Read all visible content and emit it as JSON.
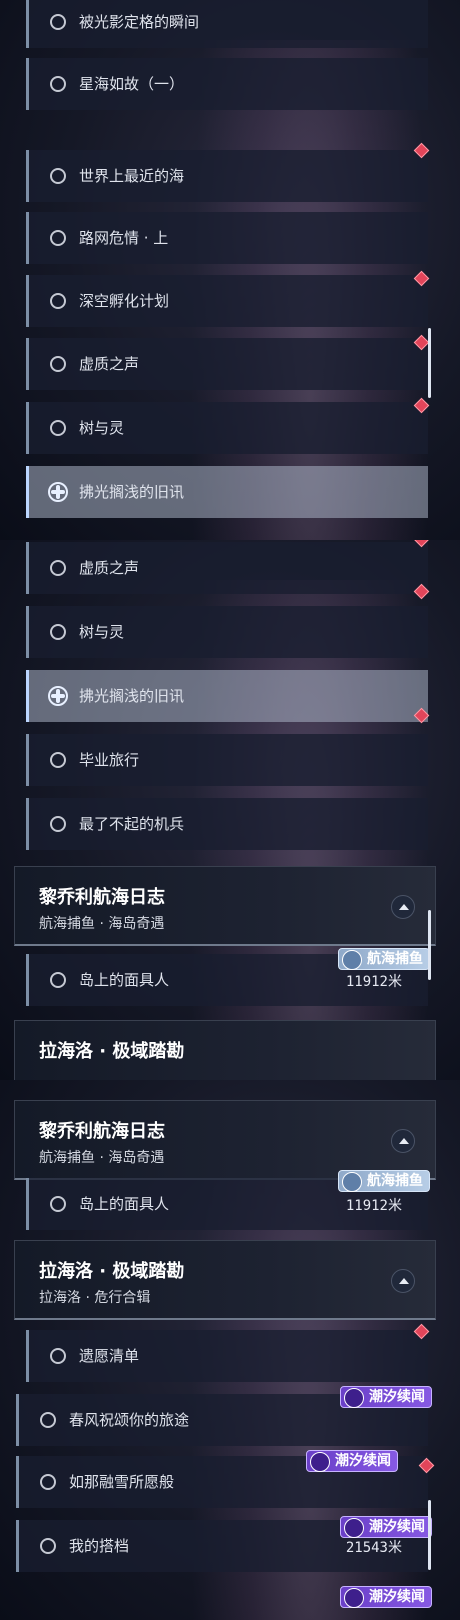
{
  "screen1": {
    "items": [
      {
        "label": "被光影定格的瞬间"
      },
      {
        "label": "星海如故（一）"
      },
      {
        "label": "世界上最近的海"
      },
      {
        "label": "路网危情 · 上"
      },
      {
        "label": "深空孵化计划"
      },
      {
        "label": "虚质之声"
      },
      {
        "label": "树与灵"
      },
      {
        "label": "拂光搁浅的旧讯"
      }
    ]
  },
  "screen2": {
    "items": [
      {
        "label": "虚质之声"
      },
      {
        "label": "树与灵"
      },
      {
        "label": "拂光搁浅的旧讯"
      },
      {
        "label": "毕业旅行"
      },
      {
        "label": "最了不起的机兵"
      }
    ],
    "group1": {
      "title": "黎乔利航海日志",
      "subtitle": "航海捕鱼 · 海岛奇遇"
    },
    "tag_blue": "航海捕鱼",
    "island_item": {
      "label": "岛上的面具人",
      "distance": "11912米"
    },
    "group2": {
      "title": "拉海洛 · 极域踏勘"
    }
  },
  "screen3": {
    "group1": {
      "title": "黎乔利航海日志",
      "subtitle": "航海捕鱼 · 海岛奇遇"
    },
    "tag_blue": "航海捕鱼",
    "island_item": {
      "label": "岛上的面具人",
      "distance": "11912米"
    },
    "group2": {
      "title": "拉海洛 · 极域踏勘",
      "subtitle": "拉海洛 · 危行合辑"
    },
    "items": [
      {
        "label": "遗愿清单"
      },
      {
        "label": "春风祝颂你的旅途"
      },
      {
        "label": "如那融雪所愿般"
      },
      {
        "label": "我的搭档",
        "distance": "21543米"
      }
    ],
    "tag_purple": "潮汐续闻"
  },
  "colors": {
    "accent_red": "#e2455a",
    "selected_border": "#bcd6ff",
    "purple_tag": "#7a4fd8",
    "blue_tag": "#a9c0dd"
  }
}
